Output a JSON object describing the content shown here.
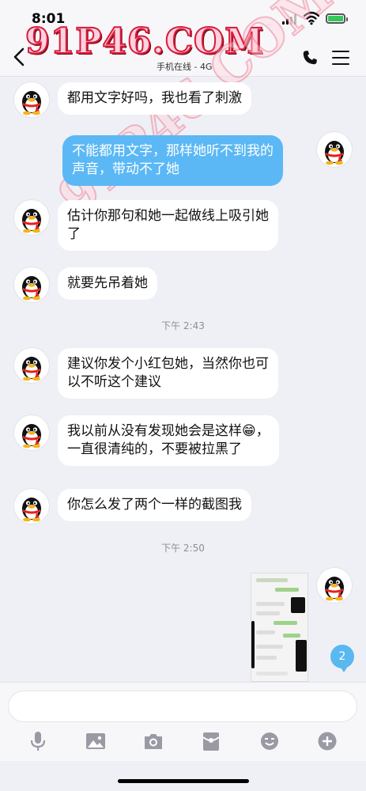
{
  "status": {
    "time": "8:01"
  },
  "header": {
    "logo": "91P46.COM",
    "subtitle": "手机在线 - 4G"
  },
  "watermark": "91P46.COM",
  "messages": [
    {
      "side": "in",
      "text": "都用文字好吗，我也看了刺激"
    },
    {
      "side": "out",
      "line1": "不能都用文字，那样她听不到我的",
      "line2": "声音，带动不了她"
    },
    {
      "side": "in",
      "line1": "估计你那句和她一起做线上吸引她",
      "line2": "了"
    },
    {
      "side": "in",
      "text": "就要先吊着她"
    },
    {
      "side": "in",
      "line1": "建议你发个小红包她，当然你也可",
      "line2": "以不听这个建议"
    },
    {
      "side": "in",
      "line1": "我以前从没有发现她会是这样",
      "emoji": "😁",
      "punct": "，",
      "line2": "一直很清纯的，不要被拉黑了"
    },
    {
      "side": "in",
      "text": "你怎么发了两个一样的截图我"
    }
  ],
  "timestamps": [
    "下午 2:43",
    "下午 2:50"
  ],
  "unread_badge": "2",
  "input": {
    "placeholder": "",
    "value": ""
  },
  "toolbar": [
    "mic-icon",
    "image-icon",
    "camera-icon",
    "red-packet-icon",
    "emoji-icon",
    "plus-icon"
  ],
  "colors": {
    "bubble_out": "#5bb8f5",
    "bubble_in": "#ffffff",
    "badge": "#59b8f0",
    "background": "#eef0f6"
  }
}
